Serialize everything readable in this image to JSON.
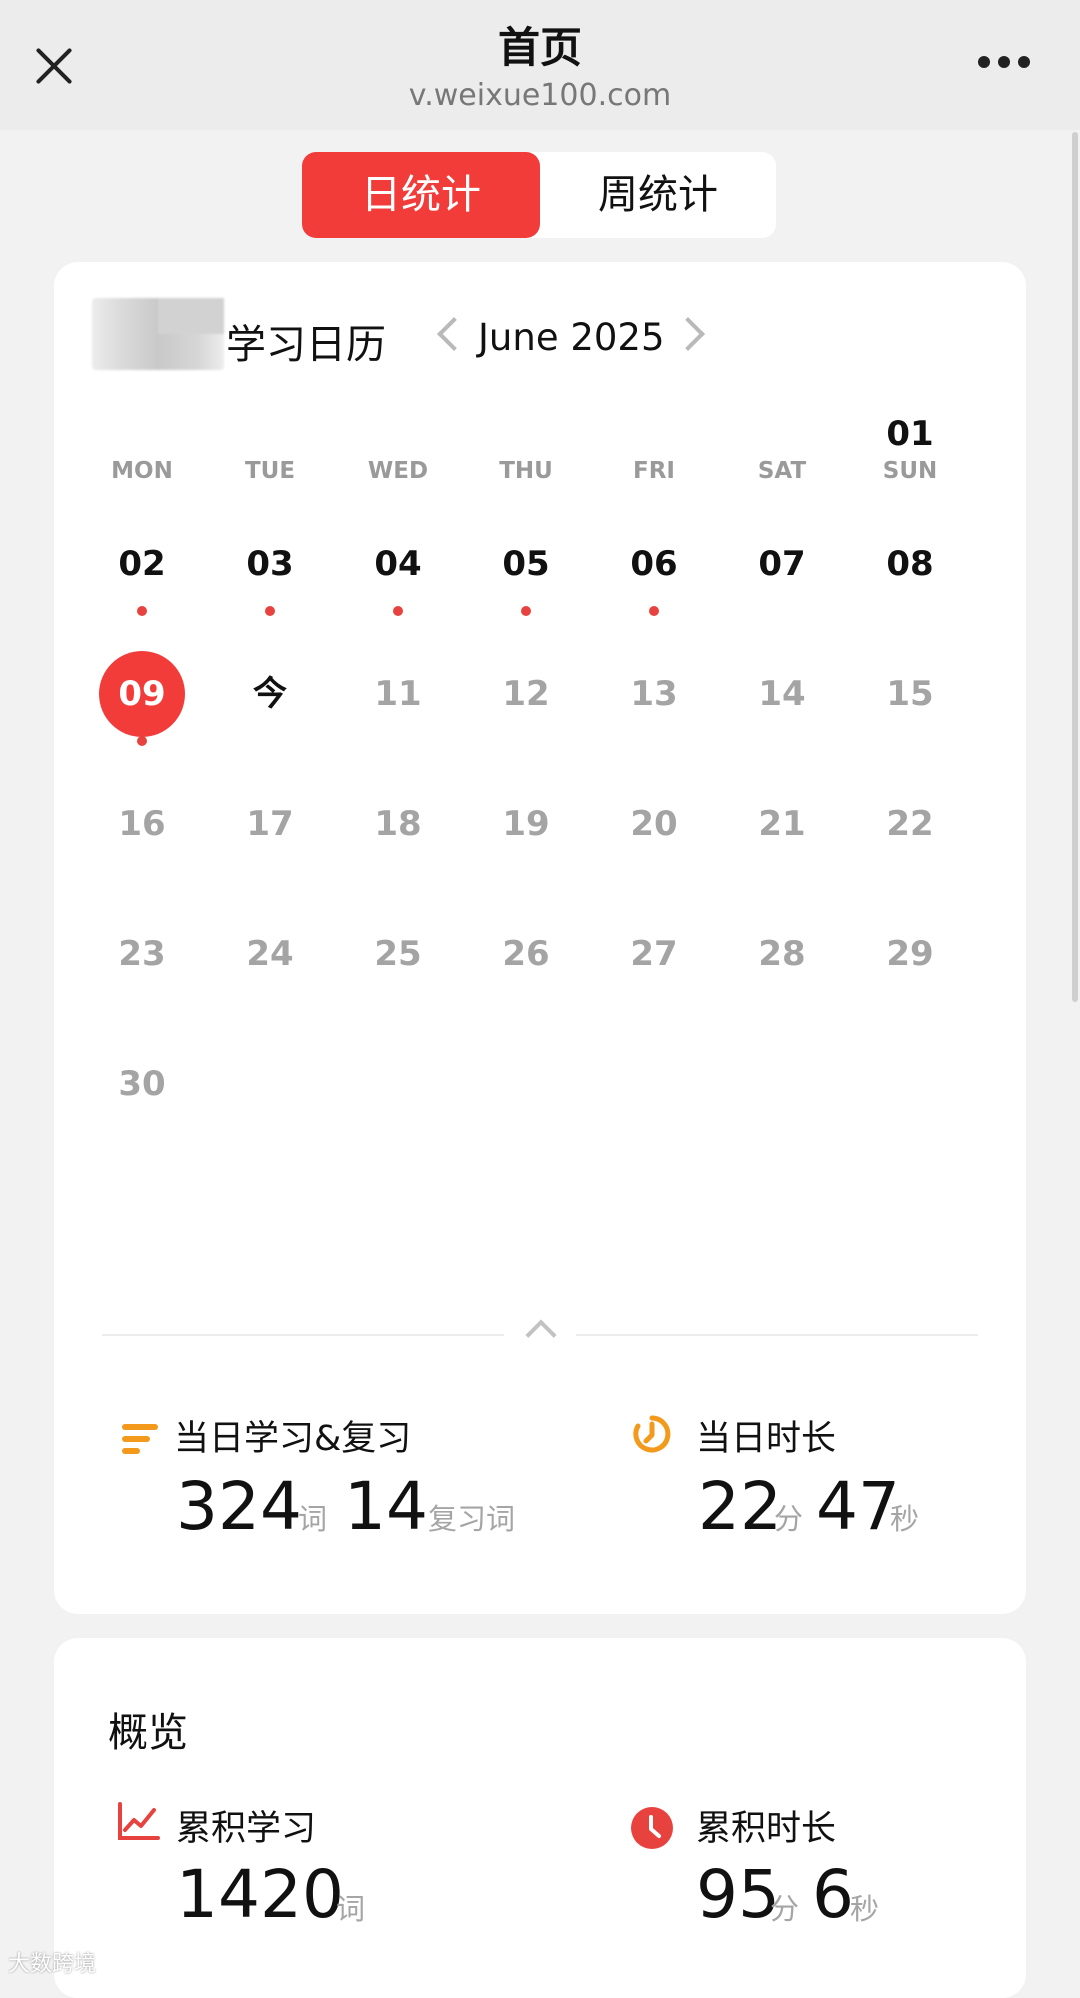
{
  "header": {
    "title": "首页",
    "url": "v.weixue100.com",
    "close_icon": "close-icon",
    "more_icon": "more-icon"
  },
  "tabs": [
    {
      "label": "日统计",
      "active": true
    },
    {
      "label": "周统计",
      "active": false
    }
  ],
  "calendar": {
    "title": "学习日历",
    "month": "June 2025",
    "weekdays": [
      "MON",
      "TUE",
      "WED",
      "THU",
      "FRI",
      "SAT",
      "SUN"
    ],
    "days": [
      {
        "label": "01"
      },
      {
        "label": "02",
        "studied": true
      },
      {
        "label": "03",
        "studied": true
      },
      {
        "label": "04",
        "studied": true
      },
      {
        "label": "05",
        "studied": true
      },
      {
        "label": "06",
        "studied": true
      },
      {
        "label": "07"
      },
      {
        "label": "08"
      },
      {
        "label": "09",
        "studied": true,
        "selected": true
      },
      {
        "label": "今"
      },
      {
        "label": "11"
      },
      {
        "label": "12"
      },
      {
        "label": "13"
      },
      {
        "label": "14"
      },
      {
        "label": "15"
      },
      {
        "label": "16"
      },
      {
        "label": "17"
      },
      {
        "label": "18"
      },
      {
        "label": "19"
      },
      {
        "label": "20"
      },
      {
        "label": "21"
      },
      {
        "label": "22"
      },
      {
        "label": "23"
      },
      {
        "label": "24"
      },
      {
        "label": "25"
      },
      {
        "label": "26"
      },
      {
        "label": "27"
      },
      {
        "label": "28"
      },
      {
        "label": "29"
      },
      {
        "label": "30"
      }
    ]
  },
  "daily": {
    "study_review": {
      "label": "当日学习&复习",
      "words": "324",
      "words_unit": "词",
      "review": "14",
      "review_unit": "复习词"
    },
    "duration": {
      "label": "当日时长",
      "minutes": "22",
      "minutes_unit": "分",
      "seconds": "47",
      "seconds_unit": "秒"
    }
  },
  "overview": {
    "title": "概览",
    "total_study": {
      "label": "累积学习",
      "value": "1420",
      "unit": "词"
    },
    "total_duration": {
      "label": "累积时长",
      "minutes": "95",
      "minutes_unit": "分",
      "seconds": "6",
      "seconds_unit": "秒"
    }
  },
  "watermark": "大数跨境",
  "colors": {
    "accent": "#f23c3a",
    "orange": "#f39a1c",
    "grey_day": "#a4a4a4"
  }
}
